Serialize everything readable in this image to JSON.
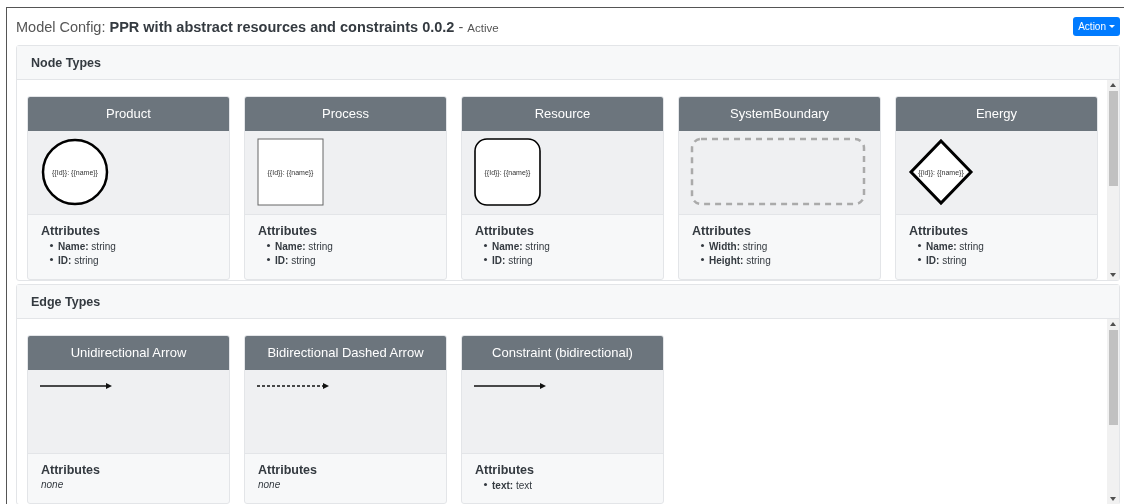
{
  "header": {
    "prefix": "Model Config:",
    "title": "PPR with abstract resources and constraints 0.0.2",
    "separator": "-",
    "status": "Active",
    "action_button": "Action"
  },
  "node_types": {
    "heading": "Node Types",
    "cards": [
      {
        "title": "Product",
        "kind": "circle",
        "shape_label": "{{Id}}: {{name}}",
        "attributes_heading": "Attributes",
        "attributes": [
          {
            "name": "Name:",
            "type": "string"
          },
          {
            "name": "ID:",
            "type": "string"
          }
        ]
      },
      {
        "title": "Process",
        "kind": "rectangle",
        "shape_label": "{{Id}}: {{name}}",
        "attributes_heading": "Attributes",
        "attributes": [
          {
            "name": "Name:",
            "type": "string"
          },
          {
            "name": "ID:",
            "type": "string"
          }
        ]
      },
      {
        "title": "Resource",
        "kind": "rounded",
        "shape_label": "{{Id}}: {{name}}",
        "attributes_heading": "Attributes",
        "attributes": [
          {
            "name": "Name:",
            "type": "string"
          },
          {
            "name": "ID:",
            "type": "string"
          }
        ]
      },
      {
        "title": "SystemBoundary",
        "kind": "boundary",
        "attributes_heading": "Attributes",
        "attributes": [
          {
            "name": "Width:",
            "type": "string"
          },
          {
            "name": "Height:",
            "type": "string"
          }
        ]
      },
      {
        "title": "Energy",
        "kind": "diamond",
        "shape_label": "{{id}}: {{name}}",
        "attributes_heading": "Attributes",
        "attributes": [
          {
            "name": "Name:",
            "type": "string"
          },
          {
            "name": "ID:",
            "type": "string"
          }
        ]
      }
    ]
  },
  "edge_types": {
    "heading": "Edge Types",
    "cards": [
      {
        "title": "Unidirectional Arrow",
        "kind": "solid",
        "attributes_heading": "Attributes",
        "note": "none"
      },
      {
        "title": "Bidirectional Dashed Arrow",
        "kind": "dashed",
        "attributes_heading": "Attributes",
        "note": "none"
      },
      {
        "title": "Constraint (bidirectional)",
        "kind": "solid",
        "attributes_heading": "Attributes",
        "attributes": [
          {
            "name": "text:",
            "type": "text"
          }
        ]
      }
    ]
  }
}
